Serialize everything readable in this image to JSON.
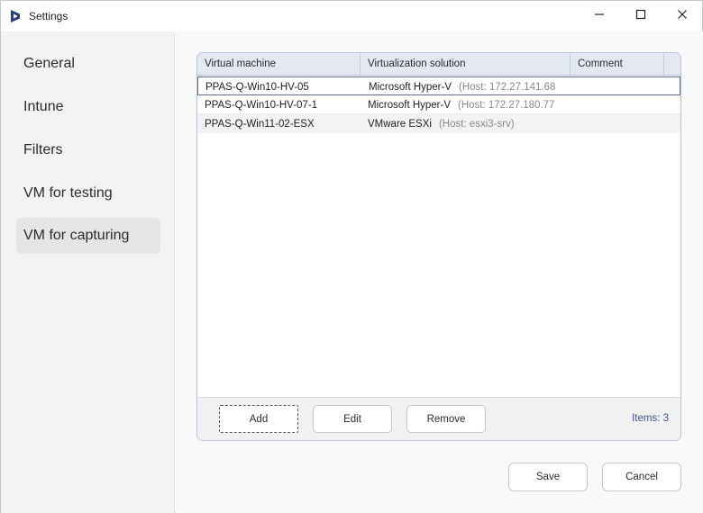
{
  "window": {
    "title": "Settings",
    "app_icon": "logo-icon",
    "controls": {
      "minimize": "minimize-icon",
      "maximize": "maximize-icon",
      "close": "close-icon"
    }
  },
  "sidebar": {
    "items": [
      {
        "label": "General"
      },
      {
        "label": "Intune"
      },
      {
        "label": "Filters"
      },
      {
        "label": "VM for testing"
      },
      {
        "label": "VM for capturing",
        "active": true
      }
    ]
  },
  "grid": {
    "columns": [
      "Virtual machine",
      "Virtualization solution",
      "Comment"
    ],
    "rows": [
      {
        "vm": "PPAS-Q-Win10-HV-05",
        "solution": "Microsoft Hyper-V",
        "host": "(Host: 172.27.141.68",
        "comment": "",
        "selected": true
      },
      {
        "vm": "PPAS-Q-Win10-HV-07-1",
        "solution": "Microsoft Hyper-V",
        "host": "(Host: 172.27.180.77",
        "comment": ""
      },
      {
        "vm": "PPAS-Q-Win11-02-ESX",
        "solution": "VMware ESXi",
        "host": "(Host: esxi3-srv)",
        "comment": ""
      }
    ],
    "buttons": {
      "add": "Add",
      "edit": "Edit",
      "remove": "Remove"
    },
    "items_count": "Items: 3"
  },
  "footer": {
    "save": "Save",
    "cancel": "Cancel"
  },
  "colors": {
    "header_bg": "#e3e8f3",
    "accent_text": "#3f5489",
    "sidebar_bg": "#f3f3f3",
    "selected_nav": "#e5e5e5"
  }
}
